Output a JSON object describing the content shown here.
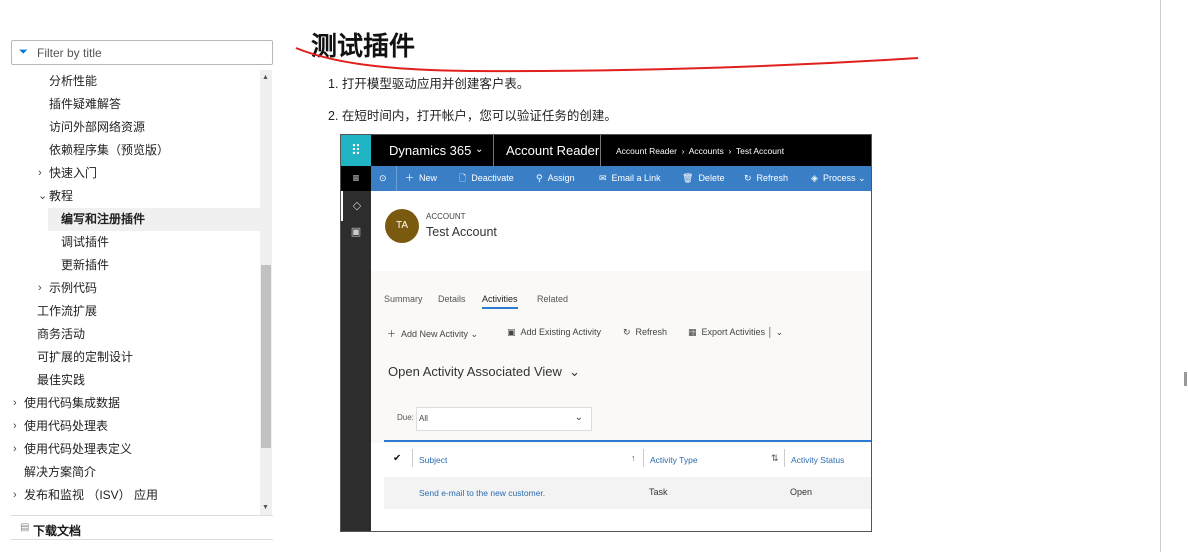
{
  "sidebar": {
    "filter_placeholder": "Filter by title",
    "items": [
      {
        "label": "分析性能"
      },
      {
        "label": "插件疑难解答"
      },
      {
        "label": "访问外部网络资源"
      },
      {
        "label": "依赖程序集（预览版）"
      },
      {
        "label": "快速入门"
      },
      {
        "label": "教程"
      },
      {
        "label": "编写和注册插件"
      },
      {
        "label": "调试插件"
      },
      {
        "label": "更新插件"
      },
      {
        "label": "示例代码"
      },
      {
        "label": "工作流扩展"
      },
      {
        "label": "商务活动"
      },
      {
        "label": "可扩展的定制设计"
      },
      {
        "label": "最佳实践"
      },
      {
        "label": "使用代码集成数据"
      },
      {
        "label": "使用代码处理表"
      },
      {
        "label": "使用代码处理表定义"
      },
      {
        "label": "解决方案简介"
      },
      {
        "label": "发布和监视 （ISV） 应用"
      }
    ],
    "download": "下载文档"
  },
  "article": {
    "title": "测试插件",
    "steps": [
      "1. 打开模型驱动应用并创建客户表。",
      "2. 在短时间内，打开帐户，您可以验证任务的创建。"
    ],
    "annotation_color": "#e0201c"
  },
  "screenshot": {
    "app": "Dynamics 365",
    "app_name": "Account Reader",
    "breadcrumb": [
      "Account Reader",
      "Accounts",
      "Test Account"
    ],
    "commands": [
      "New",
      "Deactivate",
      "Assign",
      "Email a Link",
      "Delete",
      "Refresh",
      "Process"
    ],
    "entity_label": "ACCOUNT",
    "avatar": "TA",
    "record_name": "Test Account",
    "avatar_color": "#7a5a0f",
    "tabs": [
      "Summary",
      "Details",
      "Activities",
      "Related"
    ],
    "subgrid_commands": [
      "Add New Activity",
      "Add Existing Activity",
      "Refresh",
      "Export Activities"
    ],
    "view_name": "Open Activity Associated View",
    "due_label": "Due:",
    "due_value": "All",
    "columns": [
      "Subject",
      "Activity Type",
      "Activity Status"
    ],
    "rows": [
      {
        "subject": "Send e-mail to the new customer.",
        "type": "Task",
        "status": "Open"
      }
    ]
  }
}
